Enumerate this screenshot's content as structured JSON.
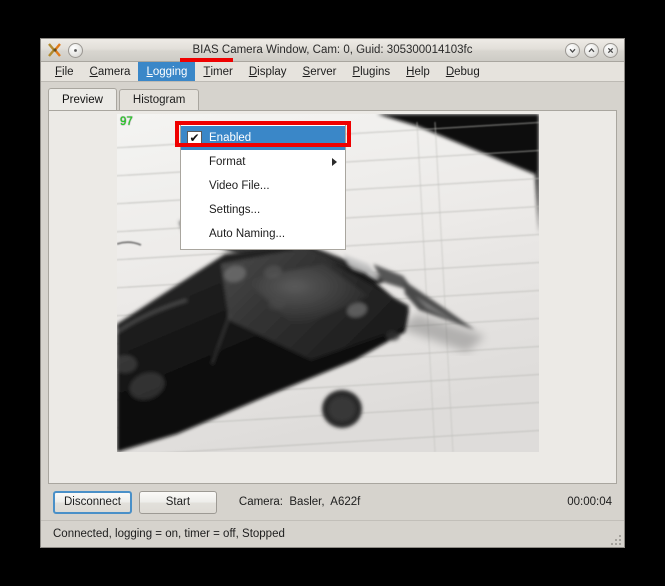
{
  "window": {
    "title": "BIAS Camera Window, Cam: 0, Guid: 305300014103fc",
    "app_icon": "bias-logo-icon",
    "titlebar_buttons": [
      {
        "name": "minimize",
        "glyph": "⌄"
      },
      {
        "name": "maximize",
        "glyph": "⌃"
      },
      {
        "name": "close",
        "glyph": "✕"
      }
    ]
  },
  "menubar": {
    "items": [
      {
        "label": "File",
        "mnemonic": "F",
        "active": false
      },
      {
        "label": "Camera",
        "mnemonic": "C",
        "active": false
      },
      {
        "label": "Logging",
        "mnemonic": "L",
        "active": true
      },
      {
        "label": "Timer",
        "mnemonic": "T",
        "active": false
      },
      {
        "label": "Display",
        "mnemonic": "D",
        "active": false
      },
      {
        "label": "Server",
        "mnemonic": "S",
        "active": false
      },
      {
        "label": "Plugins",
        "mnemonic": "P",
        "active": false
      },
      {
        "label": "Help",
        "mnemonic": "H",
        "active": false
      },
      {
        "label": "Debug",
        "mnemonic": "D",
        "active": false
      }
    ]
  },
  "logging_menu": {
    "items": [
      {
        "label": "Enabled",
        "checkbox": true,
        "checked": true,
        "check_glyph": "✔",
        "selected": true,
        "submenu": false
      },
      {
        "label": "Format",
        "checkbox": false,
        "checked": false,
        "selected": false,
        "submenu": true
      },
      {
        "label": "Video File...",
        "checkbox": false,
        "checked": false,
        "selected": false,
        "submenu": false
      },
      {
        "label": "Settings...",
        "checkbox": false,
        "checked": false,
        "selected": false,
        "submenu": false
      },
      {
        "label": "Auto Naming...",
        "checkbox": false,
        "checked": false,
        "selected": false,
        "submenu": false
      }
    ]
  },
  "tabs": [
    {
      "label": "Preview",
      "selected": true
    },
    {
      "label": "Histogram",
      "selected": false
    }
  ],
  "preview": {
    "fps_overlay": "97",
    "image_description": "grayscale photo of a digital caliper lying on lined notebook paper"
  },
  "controls": {
    "disconnect_label": "Disconnect",
    "start_label": "Start",
    "camera_info": "Camera:  Basler,  A622f",
    "timer": "00:00:04"
  },
  "statusbar": {
    "text": "Connected, logging = on, timer = off, Stopped"
  },
  "colors": {
    "desktop_background": "#000000",
    "window_background": "#d6d3cd",
    "menu_highlight": "#3a87c8",
    "annotation_red": "#ef0000",
    "fps_green": "#22dd22",
    "focus_blue": "#4a90c8"
  }
}
